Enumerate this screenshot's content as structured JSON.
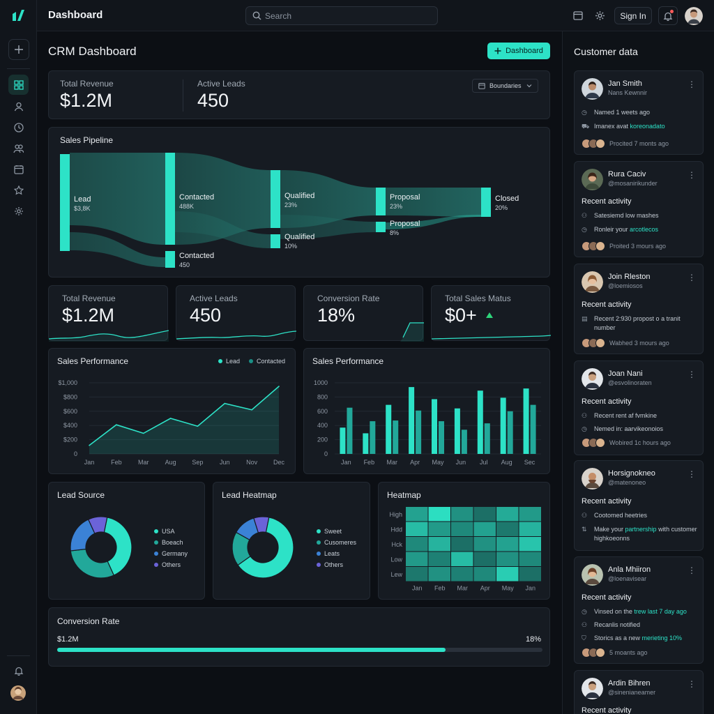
{
  "app": {
    "title": "Dashboard"
  },
  "topbar": {
    "search_placeholder": "Search",
    "signin_label": "Sign In"
  },
  "main": {
    "title": "CRM Dashboard",
    "dashboard_button": "Dashboard"
  },
  "kpi_header": {
    "revenue_label": "Total Revenue",
    "revenue_value": "$1.2M",
    "leads_label": "Active Leads",
    "leads_value": "450",
    "boundaries_label": "Boundaries"
  },
  "pipeline": {
    "title": "Sales Pipeline",
    "stages": [
      {
        "label": "Lead",
        "value": "$3,8K"
      },
      {
        "label": "Contacted",
        "value": "488K"
      },
      {
        "label": "Contacted",
        "value": "450"
      },
      {
        "label": "Qualified",
        "value": "23%"
      },
      {
        "label": "Qualified",
        "value": "10%"
      },
      {
        "label": "Proposal",
        "value": "23%"
      },
      {
        "label": "Proposal",
        "value": "8%"
      },
      {
        "label": "Closed",
        "value": "20%"
      }
    ]
  },
  "kpis": [
    {
      "label": "Total Revenue",
      "value": "$1.2M"
    },
    {
      "label": "Active Leads",
      "value": "450"
    },
    {
      "label": "Conversion Rate",
      "value": "18%"
    },
    {
      "label": "Total Sales Matus",
      "value": "$0+"
    }
  ],
  "sales_perf_line": {
    "title": "Sales Performance",
    "legend": [
      "Lead",
      "Contacted"
    ]
  },
  "sales_perf_bar": {
    "title": "Sales Performance"
  },
  "lead_source": {
    "title": "Lead Source",
    "legend": [
      "USA",
      "Boeach",
      "Germany",
      "Others"
    ]
  },
  "lead_heatmap": {
    "title": "Lead Heatmap",
    "legend": [
      "Sweet",
      "Cusomeres",
      "Leats",
      "Others"
    ]
  },
  "heatmap": {
    "title": "Heatmap"
  },
  "conversion": {
    "title": "Conversion Rate",
    "left_value": "$1.2M",
    "right_value": "18%",
    "progress": 0.8
  },
  "chart_data": [
    {
      "type": "line",
      "title": "Sales Performance",
      "categories": [
        "Jan",
        "Feb",
        "Mar",
        "Aug",
        "Sep",
        "Jun",
        "Nov",
        "Dec"
      ],
      "y_ticks": [
        "$1,000",
        "$800",
        "$600",
        "$400",
        "$200",
        "0"
      ],
      "ylim": [
        0,
        1000
      ],
      "series": [
        {
          "name": "Lead",
          "values": [
            120,
            410,
            290,
            500,
            390,
            710,
            620,
            950
          ]
        }
      ],
      "legend": [
        "Lead",
        "Contacted"
      ],
      "legend_position": "top-right"
    },
    {
      "type": "bar",
      "title": "Sales Performance",
      "categories": [
        "Jan",
        "Feb",
        "Mar",
        "Apr",
        "May",
        "Jun",
        "Jul",
        "Aug",
        "Sec"
      ],
      "y_ticks": [
        "1000",
        "800",
        "600",
        "400",
        "200",
        "0"
      ],
      "ylim": [
        0,
        1000
      ],
      "series": [
        {
          "values": [
            370,
            290,
            690,
            940,
            770,
            640,
            890,
            790,
            920
          ]
        },
        {
          "values": [
            650,
            460,
            470,
            610,
            460,
            340,
            430,
            600,
            690
          ]
        }
      ]
    },
    {
      "type": "pie",
      "title": "Lead Source",
      "labels": [
        "USA",
        "Boeach",
        "Germany",
        "Others"
      ],
      "values": [
        40,
        30,
        20,
        10
      ]
    },
    {
      "type": "pie",
      "title": "Lead Heatmap",
      "labels": [
        "Sweet",
        "Cusomeres",
        "Leats",
        "Others"
      ],
      "values": [
        62,
        18,
        12,
        8
      ]
    },
    {
      "type": "heatmap",
      "title": "Heatmap",
      "x_labels": [
        "Jan",
        "Feb",
        "Mar",
        "Apr",
        "May",
        "Jan"
      ],
      "y_labels": [
        "High",
        "Hdd",
        "Hck",
        "Low",
        "Lew"
      ],
      "values": [
        [
          0.6,
          0.95,
          0.5,
          0.3,
          0.65,
          0.55
        ],
        [
          0.75,
          0.55,
          0.45,
          0.6,
          0.35,
          0.7
        ],
        [
          0.45,
          0.7,
          0.3,
          0.5,
          0.6,
          0.8
        ],
        [
          0.55,
          0.4,
          0.75,
          0.3,
          0.5,
          0.45
        ],
        [
          0.35,
          0.5,
          0.4,
          0.45,
          0.85,
          0.3
        ]
      ]
    }
  ],
  "customers": {
    "title": "Customer data",
    "items": [
      {
        "name": "Jan Smith",
        "sub": "Nans Kewnnir",
        "lines": [
          {
            "icon": "clock-icon",
            "pre": "Named 1 weets ago",
            "acc": ""
          },
          {
            "icon": "cart-icon",
            "pre": "Imanex avat ",
            "acc": "koreonadato"
          }
        ],
        "footer": "Procited 7 monts ago"
      },
      {
        "name": "Rura Caciv",
        "sub": "@mosanirikunder",
        "heading": "Recent activity",
        "lines": [
          {
            "icon": "user-icon",
            "pre": "Satesiemd low mashes",
            "acc": ""
          },
          {
            "icon": "clock-icon",
            "pre": "Ronleir your ",
            "acc": "arcotlecos"
          }
        ],
        "footer": "Proited 3 mours ago"
      },
      {
        "name": "Join Rleston",
        "sub": "@loemiosos",
        "heading": "Recent activity",
        "lines": [
          {
            "icon": "doc-icon",
            "pre": "Recent 2:930 propost o a tranit number",
            "acc": ""
          }
        ],
        "footer": "Wabhed 3 mours ago"
      },
      {
        "name": "Joan Nani",
        "sub": "@esvolinoraten",
        "heading": "Recent activity",
        "lines": [
          {
            "icon": "user-icon",
            "pre": "Recent rent af fvmkine",
            "acc": ""
          },
          {
            "icon": "clock-icon",
            "pre": "Nemed in: aarvikeonoios",
            "acc": ""
          }
        ],
        "footer": "Wobired 1c hours ago"
      },
      {
        "name": "Horsignokneo",
        "sub": "@matenoneo",
        "heading": "Recent activity",
        "lines": [
          {
            "icon": "user-icon",
            "pre": "Cootomed heetries",
            "acc": ""
          },
          {
            "icon": "doc-icon",
            "pre": "Make your ",
            "acc": "partnership",
            "post": " with customer highkoeonns"
          }
        ],
        "footer": ""
      },
      {
        "name": "Anla Mhiiron",
        "sub": "@loenavisear",
        "heading": "Recent activity",
        "lines": [
          {
            "icon": "clock-icon",
            "pre": "Vinsed on the ",
            "acc": "trew last 7 day ago"
          },
          {
            "icon": "user-icon",
            "pre": "Recanlis notified",
            "acc": ""
          },
          {
            "icon": "doc-icon",
            "pre": "Storics as a new ",
            "acc": "merieting 10%"
          }
        ],
        "footer": "5 moants ago"
      },
      {
        "name": "Ardin Bihren",
        "sub": "@sinenianeamer",
        "heading": "Recent activity",
        "lines": [],
        "footer": ""
      }
    ]
  },
  "colors": {
    "accent": "#2de2c7",
    "accent_dark": "#1a8f86",
    "background": "#0c0f14",
    "card": "#161b22"
  }
}
